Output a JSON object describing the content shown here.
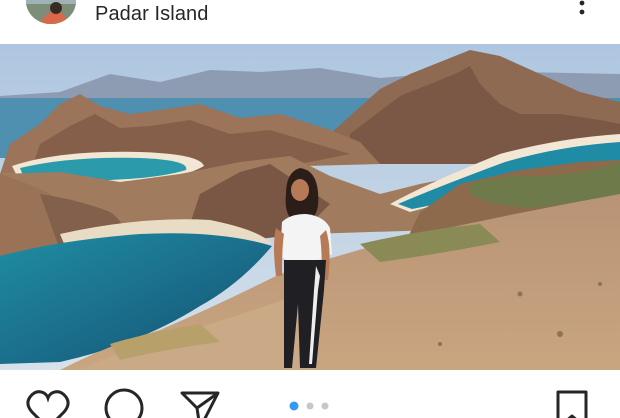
{
  "post": {
    "location": "Padar Island",
    "carousel": {
      "total": 3,
      "active": 1
    }
  },
  "icons": {
    "more": "more-vertical-icon",
    "like": "heart-icon",
    "comment": "comment-icon",
    "share": "send-icon",
    "save": "bookmark-icon"
  },
  "colors": {
    "text": "#262626",
    "accent": "#3897f0",
    "dot_inactive": "#c7c7c7"
  }
}
